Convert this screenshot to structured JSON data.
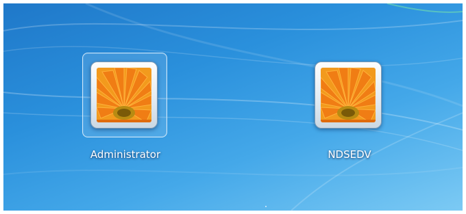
{
  "users": [
    {
      "name": "Administrator",
      "picture": "orange-flower-picture",
      "selected": true
    },
    {
      "name": "NDSEDV",
      "picture": "orange-flower-picture",
      "selected": false
    }
  ],
  "colors": {
    "background_dark": "#1f78c9",
    "background_light": "#7ccaf4",
    "petal": "#f07d14",
    "flower_center": "#b88b12"
  }
}
